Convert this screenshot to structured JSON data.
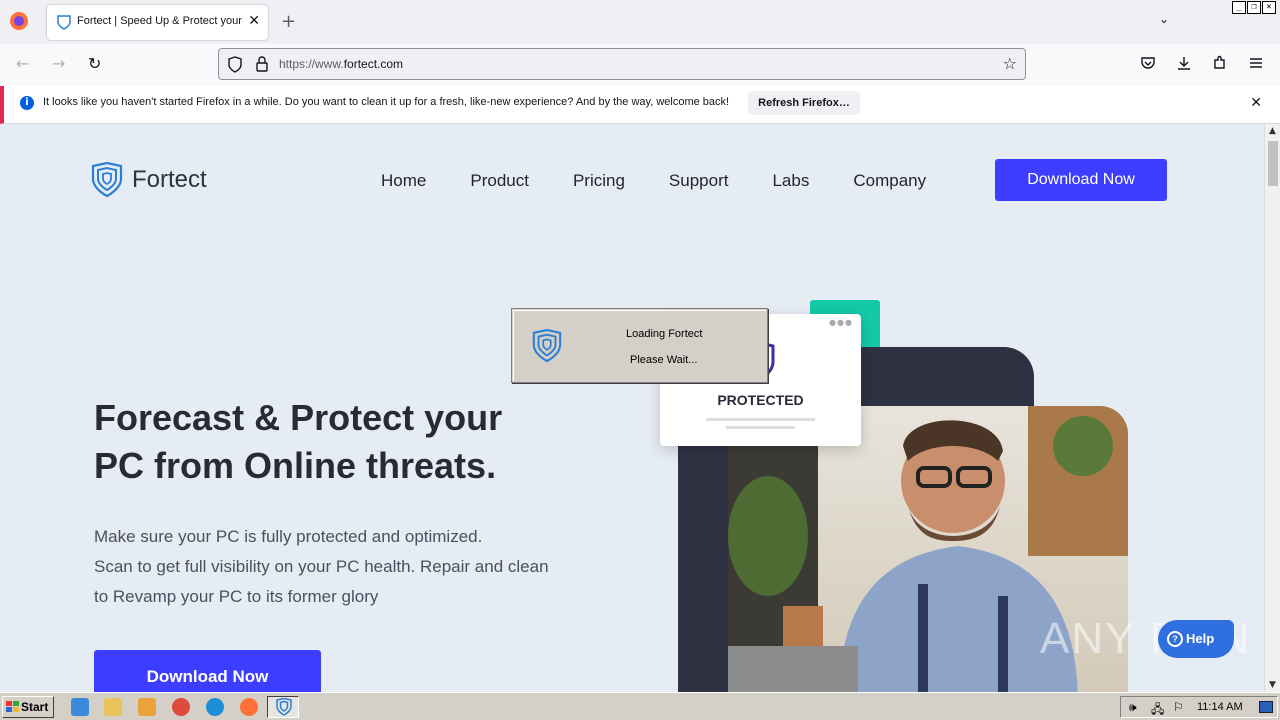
{
  "browser": {
    "tab_title": "Fortect | Speed Up & Protect your",
    "new_tab": "+",
    "url_prefix": "https://www.",
    "url_host": "fortect.com"
  },
  "notification": {
    "message": "It looks like you haven't started Firefox in a while. Do you want to clean it up for a fresh, like-new experience? And by the way, welcome back!",
    "button": "Refresh Firefox…"
  },
  "site": {
    "brand": "Fortect",
    "nav": [
      "Home",
      "Product",
      "Pricing",
      "Support",
      "Labs",
      "Company"
    ],
    "nav_cta": "Download Now",
    "headline": [
      "Forecast & Protect your",
      "PC from Online threats."
    ],
    "subtext": [
      "Make sure your PC is fully protected and optimized.",
      "Scan to get full visibility on your PC health. Repair and clean",
      "to Revamp your PC to its former glory"
    ],
    "hero_cta": "Download Now",
    "protected_label": "PROTECTED",
    "help": "Help",
    "watermark": "ANY RUN"
  },
  "dialog": {
    "line1": "Loading Fortect",
    "line2": "Please Wait..."
  },
  "taskbar": {
    "start": "Start",
    "clock": "11:14 AM"
  },
  "colors": {
    "brand_blue": "#3d3dff",
    "teal": "#13c9a8",
    "dark_panel": "#2d3142"
  }
}
